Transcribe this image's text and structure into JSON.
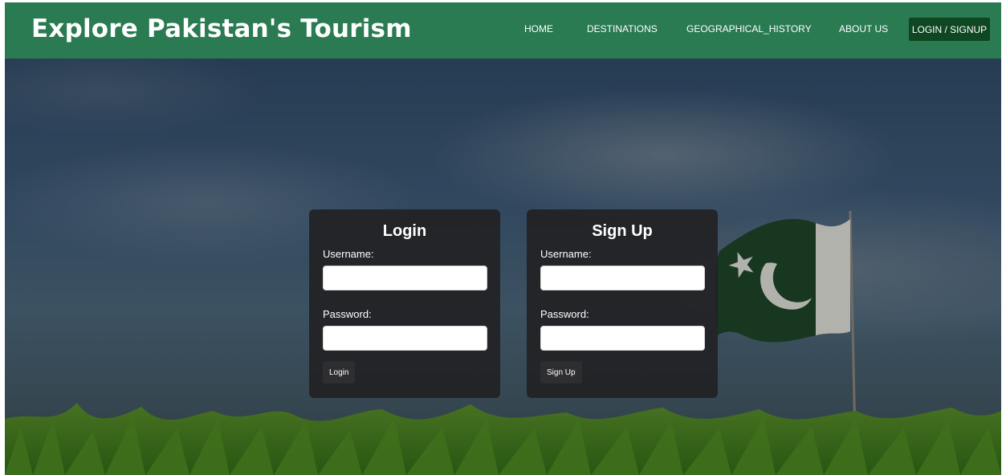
{
  "header": {
    "brand": "Explore Pakistan's Tourism",
    "nav": {
      "home": "HOME",
      "destinations": "DESTINATIONS",
      "geographical_history": "GEOGRAPHICAL_HISTORY",
      "about_us": "ABOUT US",
      "login_signup": "LOGIN / SIGNUP"
    }
  },
  "login_form": {
    "title": "Login",
    "username_label": "Username:",
    "username_value": "",
    "password_label": "Password:",
    "password_value": "",
    "submit_label": "Login"
  },
  "signup_form": {
    "title": "Sign Up",
    "username_label": "Username:",
    "username_value": "",
    "password_label": "Password:",
    "password_value": "",
    "submit_label": "Sign Up"
  },
  "colors": {
    "header_bg": "#2a7a52",
    "active_nav_bg": "#0f4722",
    "card_bg": "#222224",
    "flag_green": "#1f4a2e",
    "flag_white": "#e8e8e8"
  }
}
